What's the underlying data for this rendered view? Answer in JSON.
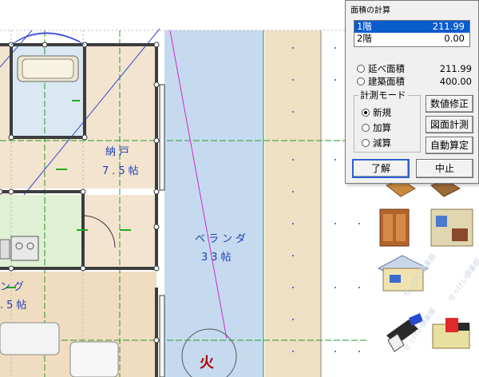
{
  "plan": {
    "room_storage_name": "納戸",
    "room_storage_size": "7.5帖",
    "room_veranda_name": "ベランダ",
    "room_veranda_size": "33帖",
    "room_living_partial": "ング",
    "room_living_size_partial": ".5帖",
    "fire_mark": "火"
  },
  "dialog": {
    "title": "面積の計算",
    "floors": [
      {
        "label": "1階",
        "value": "211.99"
      },
      {
        "label": "2階",
        "value": "0.00"
      }
    ],
    "total_floor_area_label": "延べ面積",
    "total_floor_area_value": "211.99",
    "building_area_label": "建築面積",
    "building_area_value": "400.00",
    "mode_group_label": "計測モード",
    "mode_new": "新規",
    "mode_add": "加算",
    "mode_subtract": "減算",
    "btn_edit_value": "数値修正",
    "btn_measure": "図面計測",
    "btn_auto": "自動算定",
    "btn_ok": "了解",
    "btn_cancel": "中止"
  },
  "palette": {
    "watermark": "せっけい倶楽部"
  }
}
